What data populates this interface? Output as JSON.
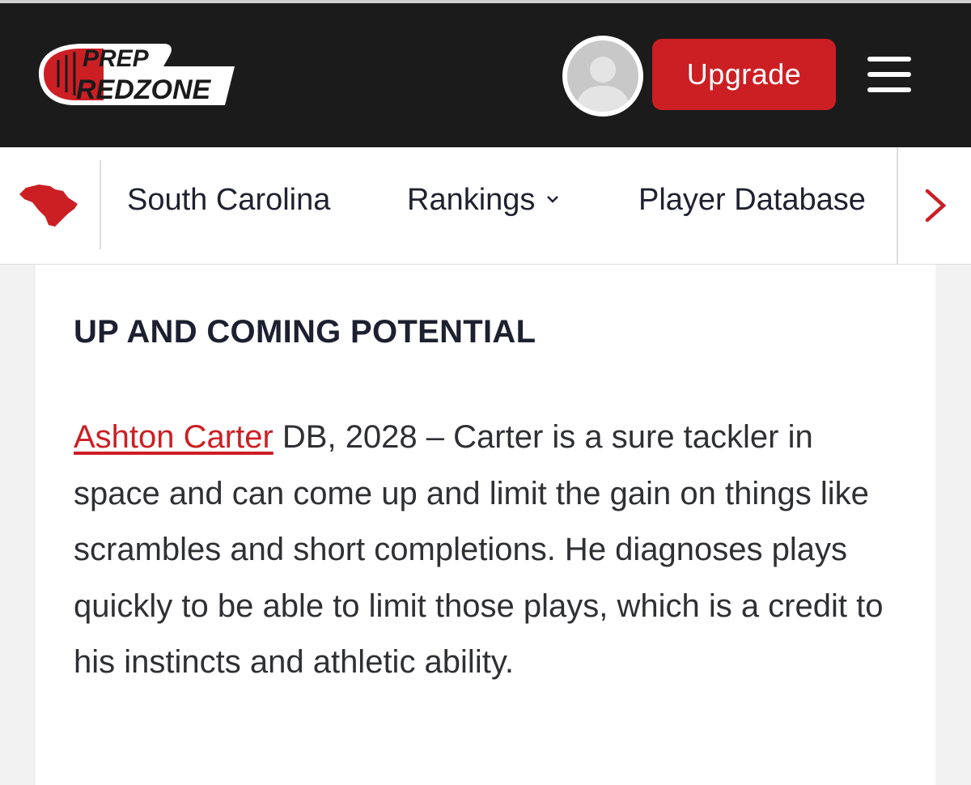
{
  "header": {
    "logo_line1": "PREP",
    "logo_line2": "REDZONE",
    "upgrade_label": "Upgrade",
    "brand_color": "#cc1f24"
  },
  "subnav": {
    "state_icon": "south-carolina-state-icon",
    "items": [
      {
        "label": "South Carolina"
      },
      {
        "label": "Rankings",
        "dropdown_icon": "chevron-down-icon"
      },
      {
        "label": "Player Database"
      }
    ],
    "next_icon": "chevron-right-icon"
  },
  "article": {
    "heading": "UP AND COMING POTENTIAL",
    "player_name": "Ashton Carter",
    "body": " DB, 2028 – Carter is a sure tackler in space and can come up and limit the gain on things like scrambles and short completions. He diagnoses plays quickly to be able to limit those plays, which is a credit to his instincts and athletic ability."
  }
}
